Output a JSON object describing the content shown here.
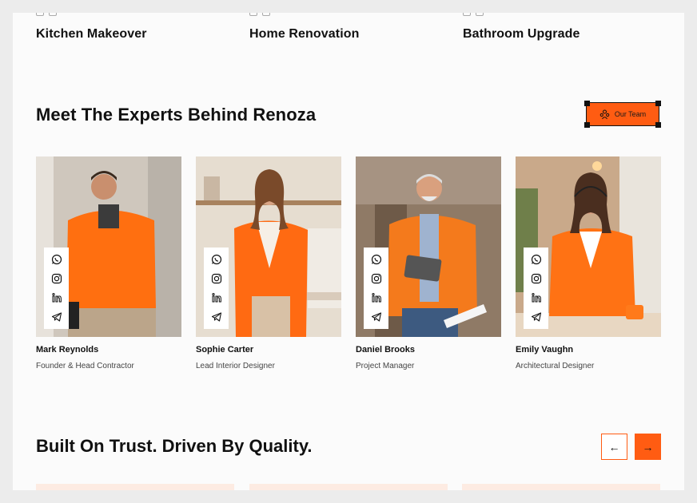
{
  "projects": [
    {
      "name": "Kitchen Makeover"
    },
    {
      "name": "Home Renovation"
    },
    {
      "name": "Bathroom Upgrade"
    }
  ],
  "experts": {
    "title": "Meet The Experts Behind Renoza",
    "button_label": "Our Team",
    "members": [
      {
        "name": "Mark Reynolds",
        "role": "Founder & Head Contractor"
      },
      {
        "name": "Sophie Carter",
        "role": "Lead Interior Designer"
      },
      {
        "name": "Daniel Brooks",
        "role": "Project Manager"
      },
      {
        "name": "Emily Vaughn",
        "role": "Architectural Designer"
      }
    ],
    "social_icons": [
      "whatsapp-icon",
      "instagram-icon",
      "linkedin-icon",
      "telegram-icon"
    ]
  },
  "trust": {
    "title": "Built On Trust. Driven By Quality.",
    "prev_glyph": "←",
    "next_glyph": "→"
  },
  "colors": {
    "accent": "#ff5c12",
    "page_bg": "#fbfbfb",
    "text": "#111111"
  }
}
